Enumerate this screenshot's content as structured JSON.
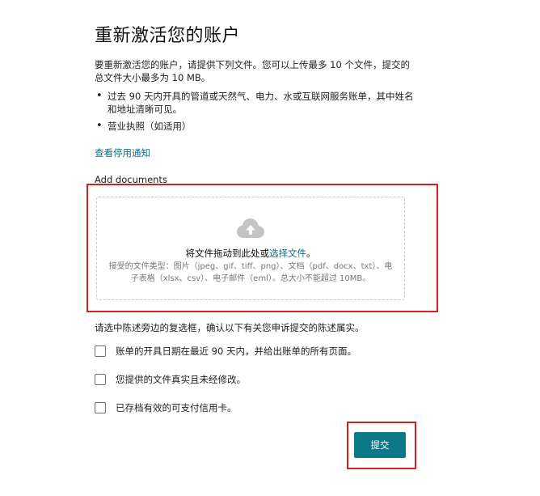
{
  "page": {
    "title": "重新激活您的账户",
    "intro": "要重新激活您的账户，请提供下列文件。您可以上传最多 10 个文件，提交的总文件大小最多为 10 MB。",
    "requirements": [
      "过去 90 天内开具的管道或天然气、电力、水或互联网服务账单，其中姓名和地址清晰可见。",
      "营业执照（如适用）"
    ],
    "deactivation_link": "查看停用通知"
  },
  "upload": {
    "label": "Add documents",
    "drag_text": "将文件拖动到此处或",
    "choose_link": "选择文件",
    "drag_suffix": "。",
    "accepted_types": "接受的文件类型：图片（jpeg、gif、tiff、png）、文档（pdf、docx、txt）、电子表格（xlsx、csv）、电子邮件（eml）。总大小不能超过 10MB。",
    "icon": "cloud-upload-icon"
  },
  "confirm": {
    "instruction": "请选中陈述旁边的复选框，确认以下有关您申诉提交的陈述属实。",
    "checkboxes": [
      {
        "label": "账单的开具日期在最近 90 天内，并给出账单的所有页面。",
        "checked": false
      },
      {
        "label": "您提供的文件真实且未经修改。",
        "checked": false
      },
      {
        "label": "已存档有效的可支付信用卡。",
        "checked": false
      }
    ]
  },
  "actions": {
    "submit_label": "提交"
  },
  "colors": {
    "accent": "#0b7a86",
    "link": "#0d6e8a",
    "highlight": "#d42020"
  }
}
